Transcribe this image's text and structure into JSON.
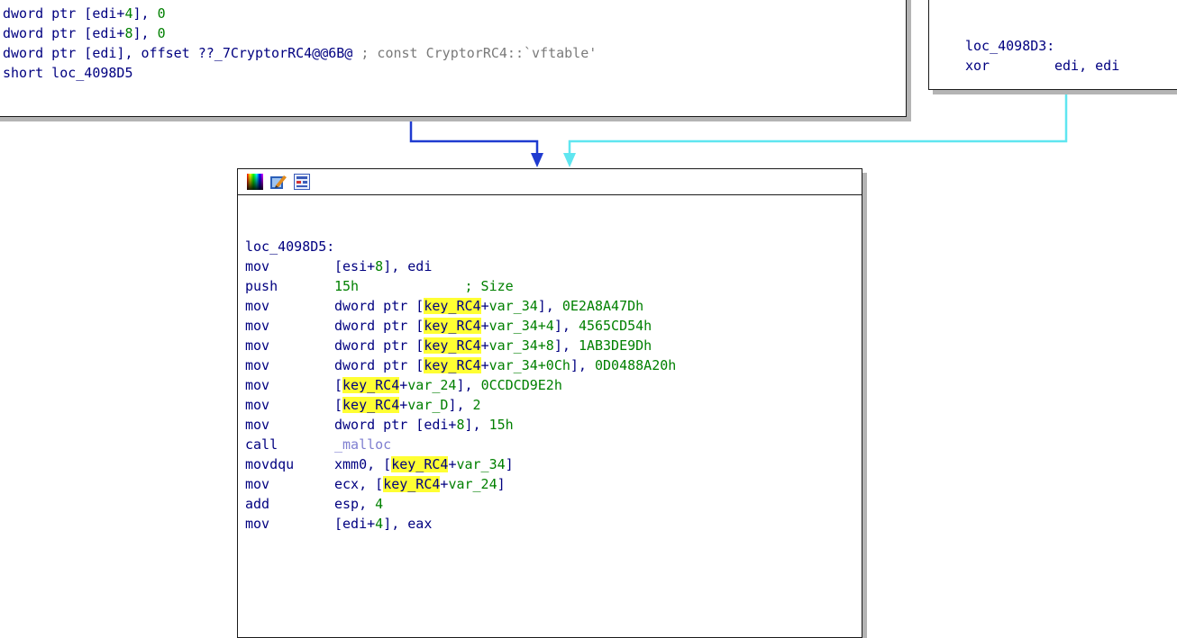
{
  "colors": {
    "mnemonic": "#000080",
    "number": "#008000",
    "comment": "#7a7a7a",
    "highlight": "#ffff33",
    "edge_blue": "#1f3bd0",
    "edge_cyan": "#5fe6f0"
  },
  "top_left_block": {
    "lines": [
      {
        "a": "dword ptr [edi+",
        "n": "4",
        "b": "], ",
        "n2": "0"
      },
      {
        "a": "dword ptr [edi+",
        "n": "8",
        "b": "], ",
        "n2": "0"
      },
      {
        "a": "dword ptr [edi], offset ",
        "ext": "??_7CryptorRC4@@6B@",
        "cm": " ; const CryptorRC4::`vftable'"
      },
      {
        "a": "short loc_4098D5"
      }
    ]
  },
  "top_right_block": {
    "label": "loc_4098D3:",
    "mnemonic": "xor",
    "operands": "edi, edi"
  },
  "main_block": {
    "toolbar_icons": [
      "color-palette-icon",
      "edit-node-icon",
      "graph-view-icon"
    ],
    "label": "loc_4098D5:",
    "instructions": [
      {
        "m": "mov",
        "parts": [
          {
            "t": "[esi+",
            "c": "mn"
          },
          {
            "t": "8",
            "c": "num"
          },
          {
            "t": "], edi",
            "c": "mn"
          }
        ]
      },
      {
        "m": "push",
        "parts": [
          {
            "t": "15h",
            "c": "num"
          },
          {
            "t": "             ; Size",
            "c": "num"
          }
        ]
      },
      {
        "m": "mov",
        "parts": [
          {
            "t": "dword ptr [",
            "c": "mn"
          },
          {
            "t": "key_RC4",
            "c": "hl"
          },
          {
            "t": "+",
            "c": "mn"
          },
          {
            "t": "var_34",
            "c": "num"
          },
          {
            "t": "], ",
            "c": "mn"
          },
          {
            "t": "0E2A8A47Dh",
            "c": "num"
          }
        ]
      },
      {
        "m": "mov",
        "parts": [
          {
            "t": "dword ptr [",
            "c": "mn"
          },
          {
            "t": "key_RC4",
            "c": "hl"
          },
          {
            "t": "+",
            "c": "mn"
          },
          {
            "t": "var_34+4",
            "c": "num"
          },
          {
            "t": "], ",
            "c": "mn"
          },
          {
            "t": "4565CD54h",
            "c": "num"
          }
        ]
      },
      {
        "m": "mov",
        "parts": [
          {
            "t": "dword ptr [",
            "c": "mn"
          },
          {
            "t": "key_RC4",
            "c": "hl"
          },
          {
            "t": "+",
            "c": "mn"
          },
          {
            "t": "var_34+8",
            "c": "num"
          },
          {
            "t": "], ",
            "c": "mn"
          },
          {
            "t": "1AB3DE9Dh",
            "c": "num"
          }
        ]
      },
      {
        "m": "mov",
        "parts": [
          {
            "t": "dword ptr [",
            "c": "mn"
          },
          {
            "t": "key_RC4",
            "c": "hl"
          },
          {
            "t": "+",
            "c": "mn"
          },
          {
            "t": "var_34+0Ch",
            "c": "num"
          },
          {
            "t": "], ",
            "c": "mn"
          },
          {
            "t": "0D0488A20h",
            "c": "num"
          }
        ]
      },
      {
        "m": "mov",
        "parts": [
          {
            "t": "[",
            "c": "mn"
          },
          {
            "t": "key_RC4",
            "c": "hl"
          },
          {
            "t": "+",
            "c": "mn"
          },
          {
            "t": "var_24",
            "c": "num"
          },
          {
            "t": "], ",
            "c": "mn"
          },
          {
            "t": "0CCDCD9E2h",
            "c": "num"
          }
        ]
      },
      {
        "m": "mov",
        "parts": [
          {
            "t": "[",
            "c": "mn"
          },
          {
            "t": "key_RC4",
            "c": "hl"
          },
          {
            "t": "+",
            "c": "mn"
          },
          {
            "t": "var_D",
            "c": "num"
          },
          {
            "t": "], ",
            "c": "mn"
          },
          {
            "t": "2",
            "c": "num"
          }
        ]
      },
      {
        "m": "mov",
        "parts": [
          {
            "t": "dword ptr [edi+",
            "c": "mn"
          },
          {
            "t": "8",
            "c": "num"
          },
          {
            "t": "], ",
            "c": "mn"
          },
          {
            "t": "15h",
            "c": "num"
          }
        ]
      },
      {
        "m": "call",
        "parts": [
          {
            "t": "_malloc",
            "c": "fn"
          }
        ]
      },
      {
        "m": "movdqu",
        "parts": [
          {
            "t": "xmm0, [",
            "c": "mn"
          },
          {
            "t": "key_RC4",
            "c": "hl"
          },
          {
            "t": "+",
            "c": "mn"
          },
          {
            "t": "var_34",
            "c": "num"
          },
          {
            "t": "]",
            "c": "mn"
          }
        ]
      },
      {
        "m": "mov",
        "parts": [
          {
            "t": "ecx, [",
            "c": "mn"
          },
          {
            "t": "key_RC4",
            "c": "hl"
          },
          {
            "t": "+",
            "c": "mn"
          },
          {
            "t": "var_24",
            "c": "num"
          },
          {
            "t": "]",
            "c": "mn"
          }
        ]
      },
      {
        "m": "add",
        "parts": [
          {
            "t": "esp, ",
            "c": "mn"
          },
          {
            "t": "4",
            "c": "num"
          }
        ]
      },
      {
        "m": "mov",
        "parts": [
          {
            "t": "[edi+",
            "c": "mn"
          },
          {
            "t": "4",
            "c": "num"
          },
          {
            "t": "], eax",
            "c": "mn"
          }
        ]
      }
    ]
  }
}
